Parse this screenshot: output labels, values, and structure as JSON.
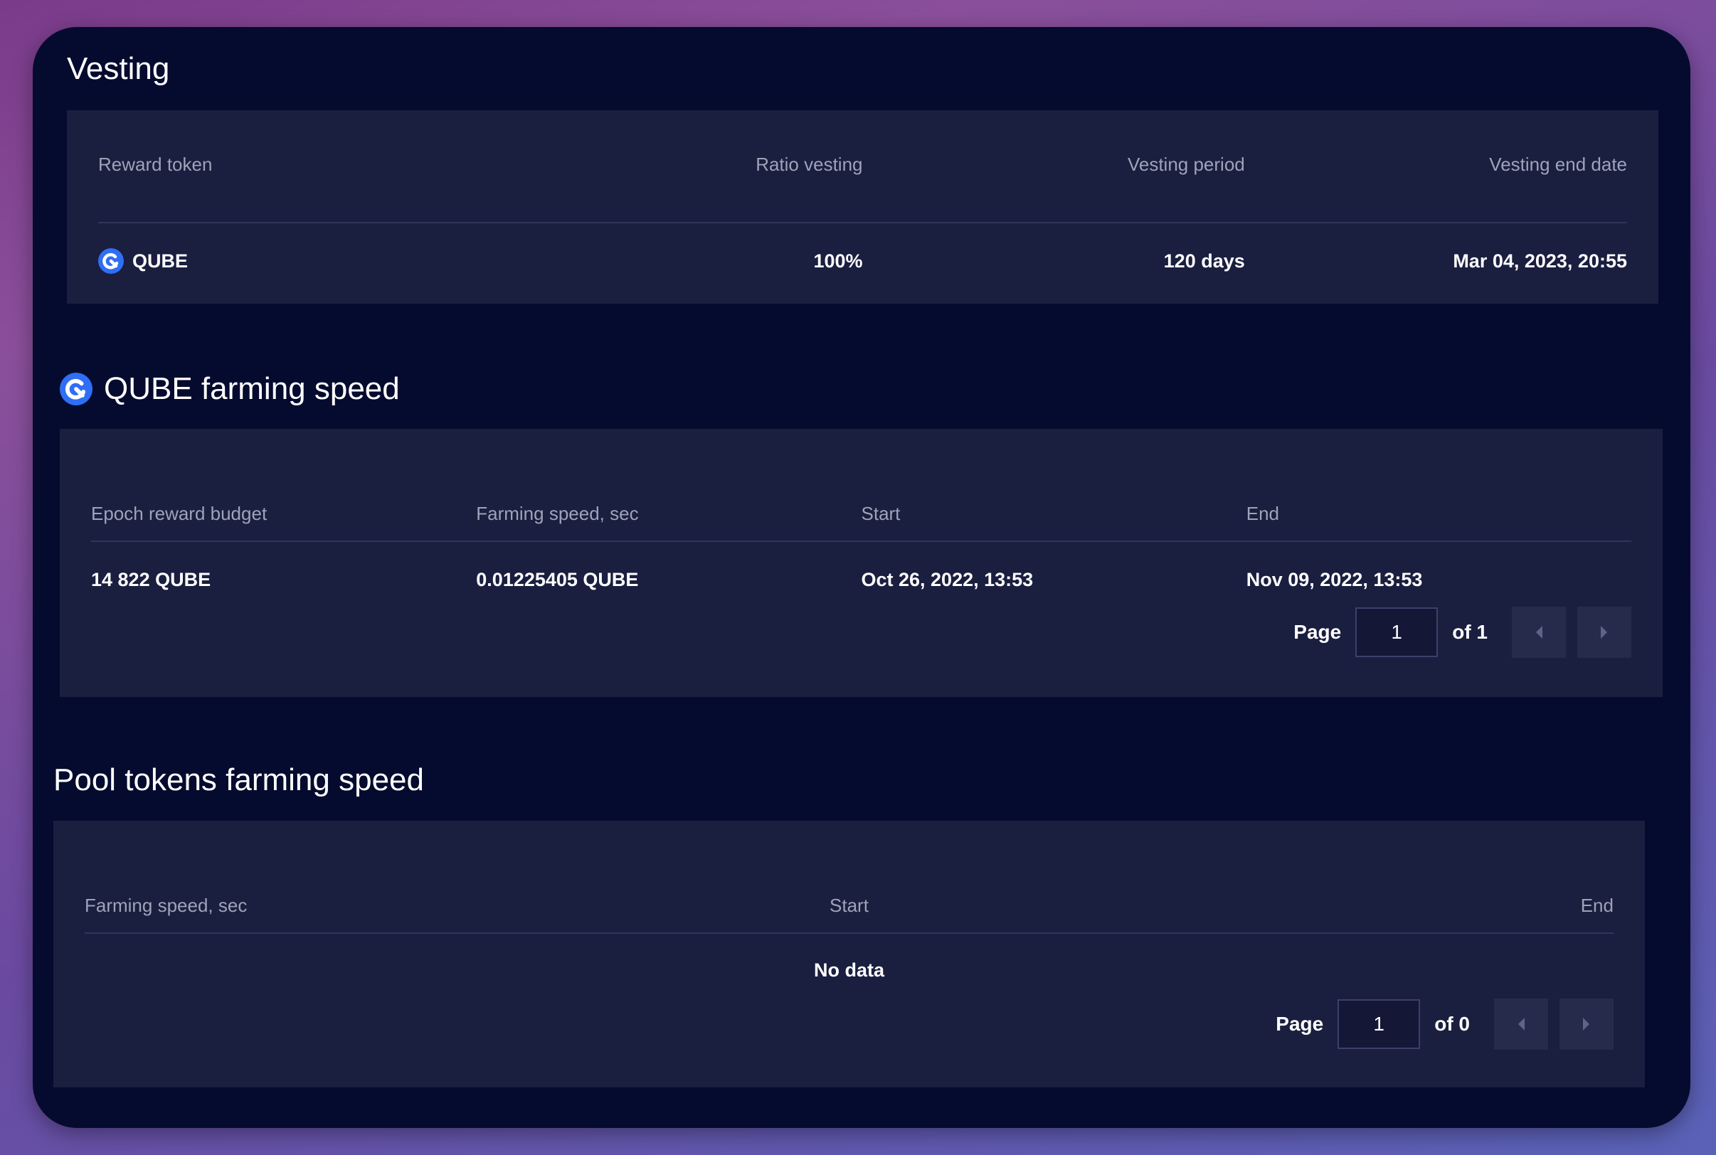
{
  "vesting": {
    "title": "Vesting",
    "columns": [
      "Reward token",
      "Ratio vesting",
      "Vesting period",
      "Vesting end date"
    ],
    "row": {
      "token": "QUBE",
      "ratio": "100%",
      "period": "120 days",
      "end_date": "Mar 04, 2023, 20:55"
    }
  },
  "qube_speed": {
    "title": "QUBE farming speed",
    "columns": [
      "Epoch reward budget",
      "Farming speed, sec",
      "Start",
      "End"
    ],
    "row": {
      "budget": "14 822 QUBE",
      "speed": "0.01225405 QUBE",
      "start": "Oct 26, 2022, 13:53",
      "end": "Nov 09, 2022, 13:53"
    },
    "pager": {
      "page_label": "Page",
      "page_value": "1",
      "of_label": "of 1"
    }
  },
  "pool_speed": {
    "title": "Pool tokens farming speed",
    "columns": [
      "Farming speed, sec",
      "Start",
      "End"
    ],
    "empty": "No data",
    "pager": {
      "page_label": "Page",
      "page_value": "1",
      "of_label": "of 0"
    }
  },
  "icons": {
    "token_logo": "qube-logo-icon",
    "prev": "chevron-left-icon",
    "next": "chevron-right-icon"
  },
  "colors": {
    "accent": "#2f6ef5",
    "panel": "#1a1e3f",
    "background": "#050b2e"
  }
}
